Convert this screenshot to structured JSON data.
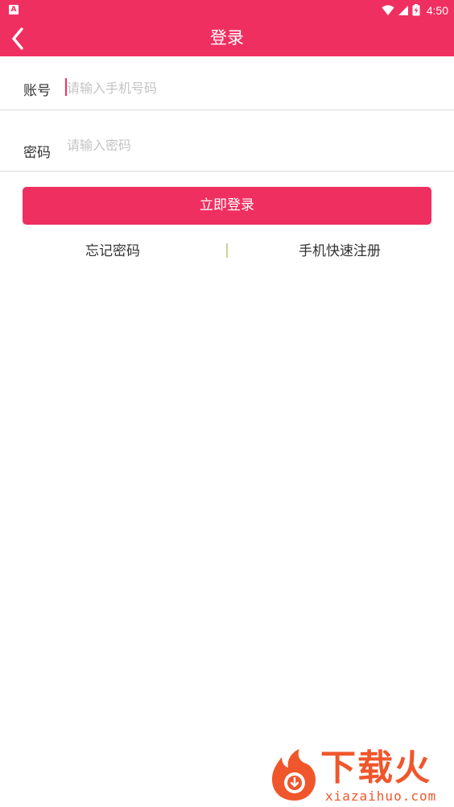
{
  "status_bar": {
    "app_indicator": "A",
    "time": "4:50",
    "icons": [
      "wifi-icon",
      "signal-icon",
      "battery-charging-icon"
    ]
  },
  "app_bar": {
    "back_icon": "chevron-left-icon",
    "title": "登录"
  },
  "form": {
    "account": {
      "label": "账号",
      "placeholder": "请输入手机号码",
      "value": ""
    },
    "password": {
      "label": "密码",
      "placeholder": "请输入密码",
      "value": ""
    },
    "login_button": "立即登录"
  },
  "links": {
    "forgot_password": "忘记密码",
    "quick_register": "手机快速注册"
  },
  "watermark": {
    "brand": "下载火",
    "url": "xiazaihuo.com"
  },
  "colors": {
    "accent": "#ef2f60",
    "watermark": "#f0562c",
    "divider": "#d9d9d9",
    "link_divider": "#c8d29a"
  }
}
